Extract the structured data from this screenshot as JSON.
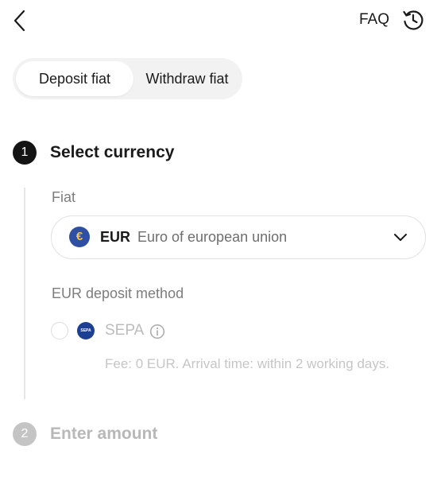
{
  "header": {
    "back_icon": "chevron-left-icon",
    "faq_label": "FAQ",
    "history_icon": "history-icon"
  },
  "tabs": [
    {
      "label": "Deposit fiat",
      "active": true
    },
    {
      "label": "Withdraw fiat",
      "active": false
    }
  ],
  "steps": [
    {
      "number": "1",
      "title": "Select currency",
      "active": true
    },
    {
      "number": "2",
      "title": "Enter amount",
      "active": false
    }
  ],
  "fiat": {
    "label": "Fiat",
    "selected_code": "EUR",
    "selected_name": "Euro of european union",
    "currency_symbol": "€",
    "icon": "euro-icon"
  },
  "deposit_method": {
    "label": "EUR deposit method",
    "option_name": "SEPA",
    "logo_text": "SEPA",
    "fee_text": "Fee: 0 EUR. Arrival time: within 2 working days.",
    "selected": false
  },
  "colors": {
    "active_step": "#141414",
    "inactive_step": "#c4c4c4",
    "euro_icon_bg": "#2f4fa3",
    "sepa_logo_bg": "#1c3f94"
  }
}
